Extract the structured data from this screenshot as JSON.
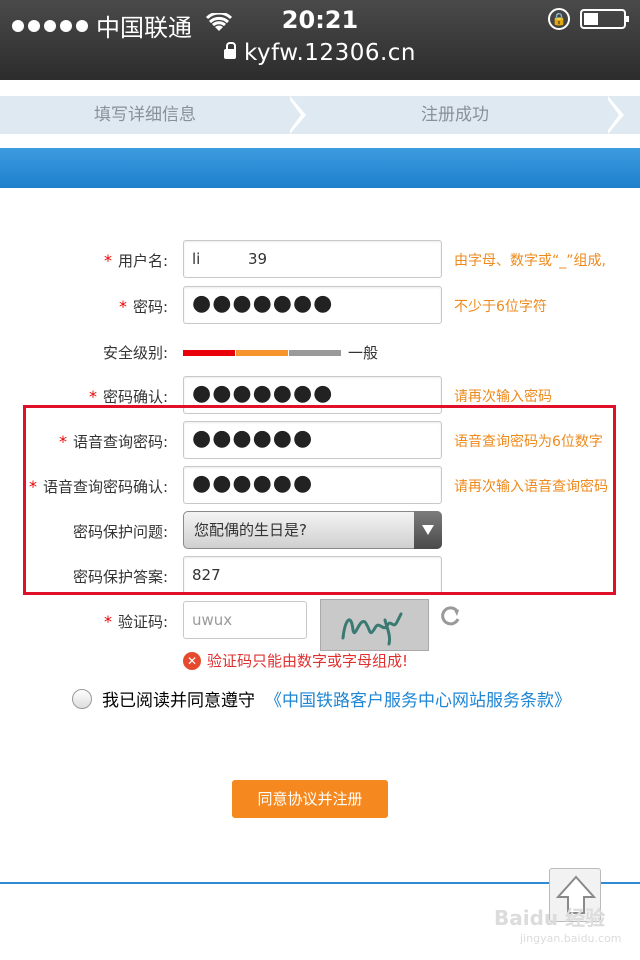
{
  "status_bar": {
    "carrier": "中国联通",
    "time": "20:21",
    "url": "kyfw.12306.cn"
  },
  "steps": [
    "填写详细信息",
    "注册成功"
  ],
  "form": {
    "username": {
      "label": "用户名:",
      "value": "li          39",
      "hint": "由字母、数字或“_”组成,"
    },
    "password": {
      "label": "密码:",
      "value": "●●●●●●●",
      "hint": "不少于6位字符"
    },
    "security_level": {
      "label": "安全级别:",
      "text": "一般",
      "colors": [
        "#e8000b",
        "#f5952b",
        "#9a9a9a"
      ]
    },
    "password_confirm": {
      "label": "密码确认:",
      "value": "●●●●●●●",
      "hint": "请再次输入密码"
    },
    "voice_password": {
      "label": "语音查询密码:",
      "value": "●●●●●●",
      "hint": "语音查询密码为6位数字"
    },
    "voice_password_confirm": {
      "label": "语音查询密码确认:",
      "value": "●●●●●●",
      "hint": "请再次输入语音查询密码"
    },
    "security_question": {
      "label": "密码保护问题:",
      "value": "您配偶的生日是?"
    },
    "security_answer": {
      "label": "密码保护答案:",
      "value": "827"
    },
    "captcha": {
      "label": "验证码:",
      "value": "uwux",
      "error": "验证码只能由数字或字母组成!"
    }
  },
  "agreement": {
    "text": "我已阅读并同意遵守",
    "link": "《中国铁路客户服务中心网站服务条款》"
  },
  "submit_label": "同意协议并注册",
  "watermark": {
    "main": "Baidu 经验",
    "sub": "jingyan.baidu.com"
  },
  "colors": {
    "accent_blue": "#1e7fcc",
    "hint_orange": "#ee8a1c",
    "highlight_red": "#e0102a",
    "button_orange": "#f5891f"
  }
}
